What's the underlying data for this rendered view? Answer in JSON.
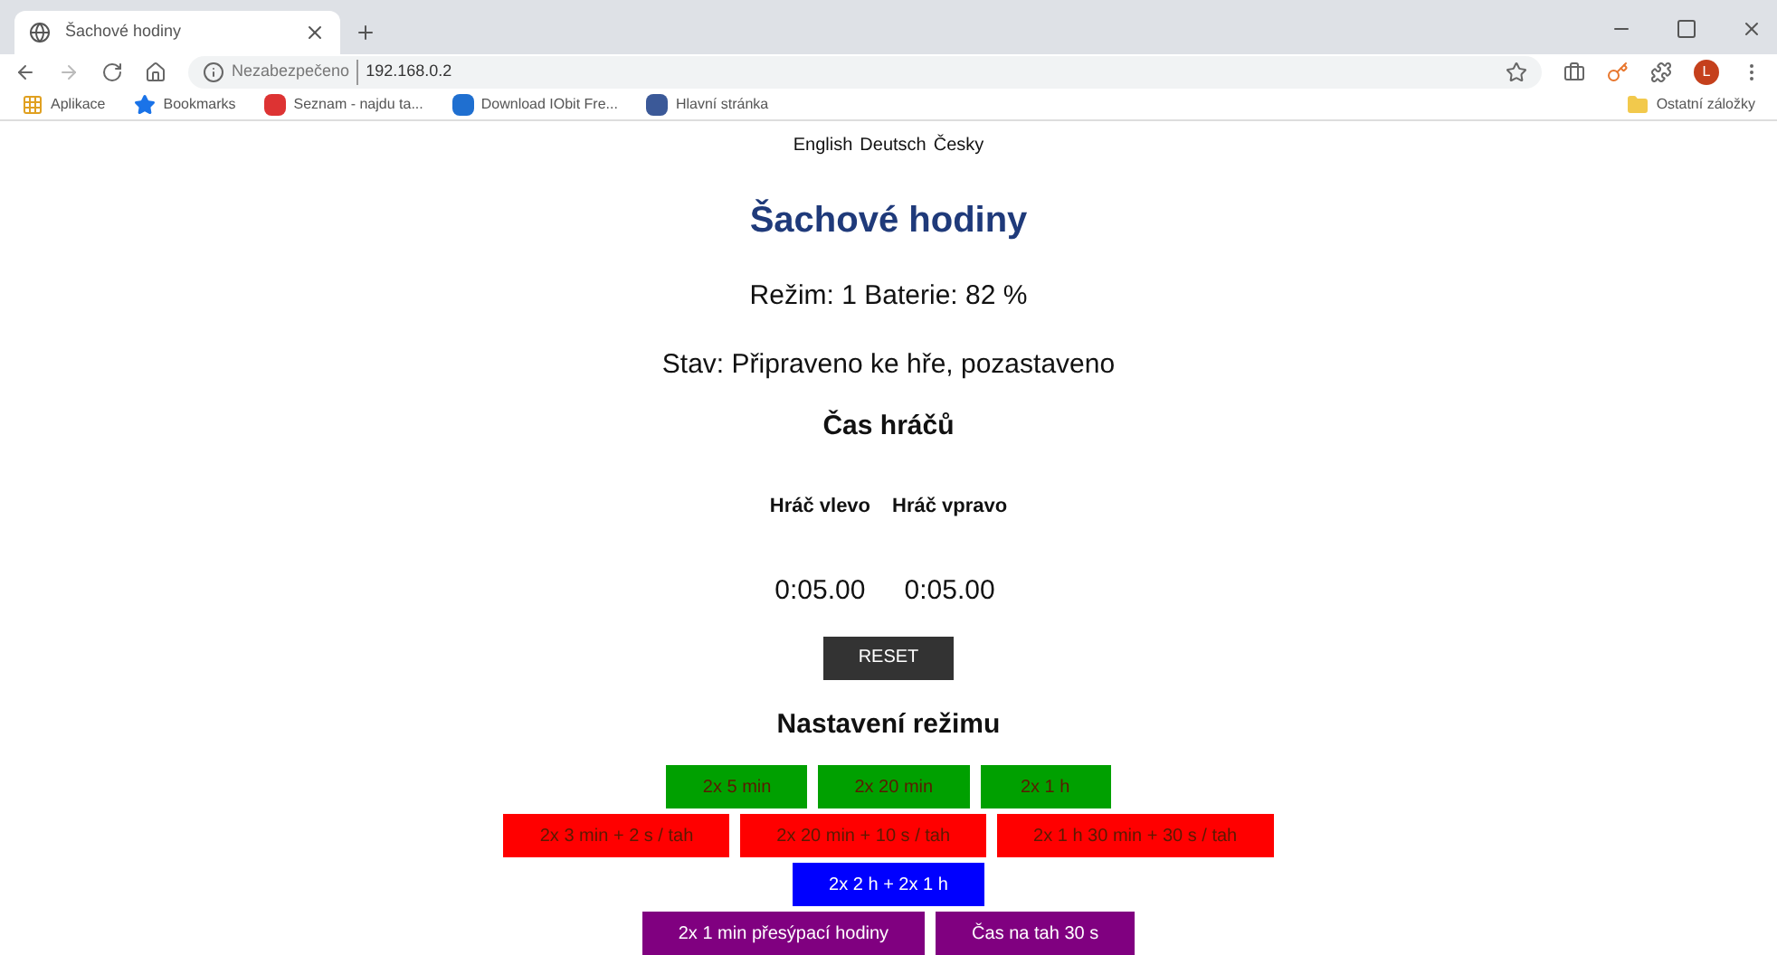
{
  "browser": {
    "tab_title": "Šachové hodiny",
    "security": "Nezabezpečeno",
    "url": "192.168.0.2",
    "bookmarks": [
      "Aplikace",
      "Bookmarks",
      "Seznam - najdu ta...",
      "Download IObit Fre...",
      "Hlavní stránka"
    ],
    "other_bookmarks": "Ostatní záložky",
    "profile_initial": "L"
  },
  "languages": [
    "English",
    "Deutsch",
    "Česky"
  ],
  "title": "Šachové hodiny",
  "mode_line": "Režim: 1 Baterie: 82 %",
  "status_line": "Stav: Připraveno ke hře, pozastaveno",
  "players_heading": "Čas hráčů",
  "players": [
    {
      "name": "Hráč vlevo",
      "time": "0:05.00"
    },
    {
      "name": "Hráč vpravo",
      "time": "0:05.00"
    }
  ],
  "reset_button": "RESET",
  "settings_heading": "Nastavení režimu",
  "mode_rows": [
    [
      {
        "label": "2x 5 min",
        "color": "#00a000"
      },
      {
        "label": "2x 20 min",
        "color": "#00a000"
      },
      {
        "label": "2x 1 h",
        "color": "#00a000"
      }
    ],
    [
      {
        "label": "2x 3 min + 2 s / tah",
        "color": "#ff0000"
      },
      {
        "label": "2x 20 min + 10 s / tah",
        "color": "#ff0000"
      },
      {
        "label": "2x 1 h 30 min + 30 s / tah",
        "color": "#ff0000"
      }
    ],
    [
      {
        "label": "2x 2 h + 2x 1 h",
        "color": "#0000ff"
      }
    ],
    [
      {
        "label": "2x 1 min přesýpací hodiny",
        "color": "#800080"
      },
      {
        "label": "Čas na tah 30 s",
        "color": "#800080"
      }
    ]
  ]
}
